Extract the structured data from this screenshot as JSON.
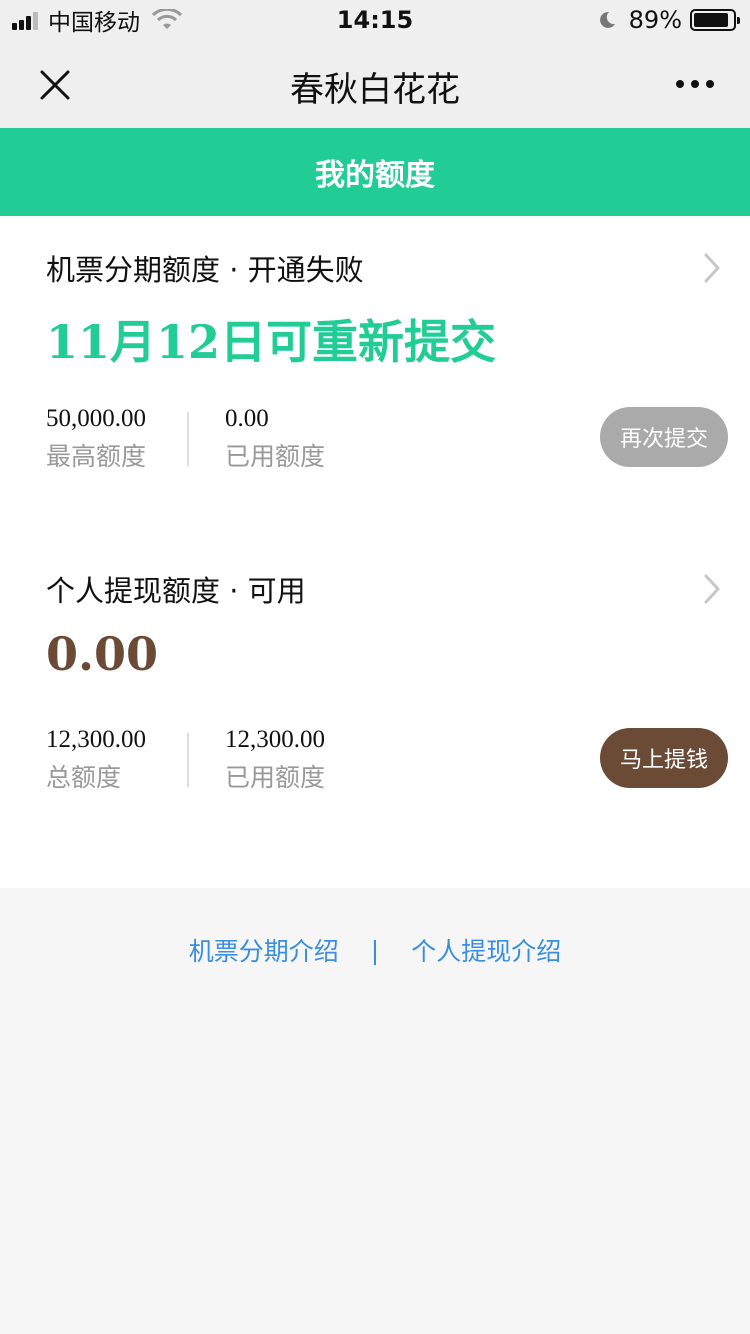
{
  "status_bar": {
    "carrier": "中国移动",
    "time": "14:15",
    "battery_percent": "89%",
    "battery_level": 0.89,
    "icons": [
      "signal-icon",
      "wifi-icon",
      "moon-icon",
      "battery-icon"
    ]
  },
  "nav": {
    "title": "春秋白花花",
    "close_icon": "close-icon",
    "more_icon": "more-icon"
  },
  "banner": {
    "label": "我的额度"
  },
  "cards": [
    {
      "title": "机票分期额度 · 开通失败",
      "big_value": "11月12日可重新提交",
      "big_value_color": "#22cc95",
      "stat1_value": "50,000.00",
      "stat1_label": "最高额度",
      "stat2_value": "0.00",
      "stat2_label": "已用额度",
      "button_label": "再次提交",
      "button_color": "#aaaaaa"
    },
    {
      "title": "个人提现额度 · 可用",
      "big_value": "0.00",
      "big_value_color": "#6b4a36",
      "stat1_value": "12,300.00",
      "stat1_label": "总额度",
      "stat2_value": "12,300.00",
      "stat2_label": "已用额度",
      "button_label": "马上提钱",
      "button_color": "#6b4a36"
    }
  ],
  "footer": {
    "link1": "机票分期介绍",
    "separator": "|",
    "link2": "个人提现介绍",
    "link_color": "#3a8ee0"
  }
}
